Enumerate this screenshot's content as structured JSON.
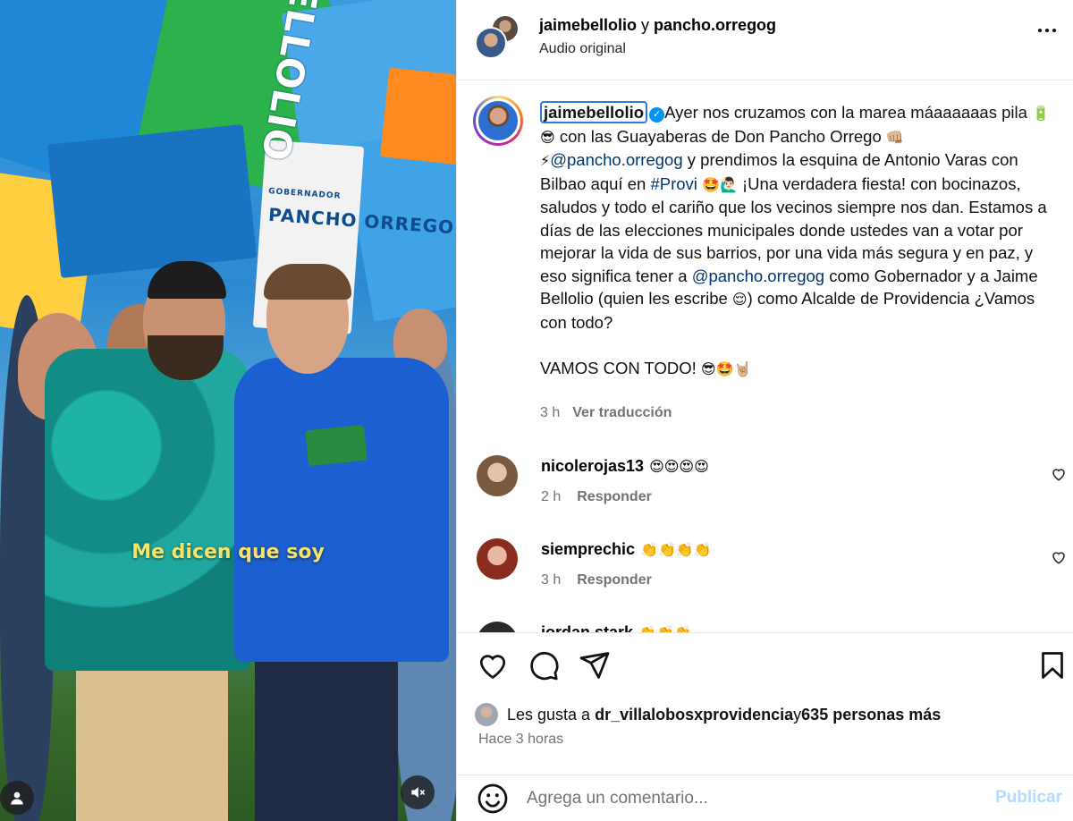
{
  "media": {
    "caption": "Me dicen que soy",
    "flag_texts": [
      "PANCHO ORREGO",
      "GOBERNADOR",
      "BELLOLIO"
    ]
  },
  "header": {
    "user1": "jaimebellolio",
    "joiner": " y ",
    "user2": "pancho.orregog",
    "audio": "Audio original"
  },
  "post": {
    "author": "jaimebellolio",
    "segments": {
      "a": "Ayer nos cruzamos con la marea máaaaaaas pila ",
      "b": " con las Guayaberas de Don Pancho Orrego ",
      "c": "@pancho.orregog",
      "d": " y prendimos la esquina de Antonio Varas con Bilbao aquí en ",
      "e": "#Provi",
      "f": " ¡Una verdadera fiesta! con bocinazos, saludos y todo el cariño que los vecinos siempre nos dan. Estamos a días de las elecciones municipales donde ustedes van a votar por mejorar la vida de sus barrios, por una vida más segura y en paz, y eso significa tener a ",
      "g": "@pancho.orregog",
      "h": " como Gobernador y a Jaime Bellolio (quien les escribe ",
      "i": ") como Alcalde de Providencia ¿Vamos con todo?",
      "j": "VAMOS CON TODO! "
    },
    "emoji": {
      "e1": "🔋 😎",
      "e2": "👊🏼",
      "e3": "⚡",
      "e4": "🤩🙋🏻‍♂️",
      "e5": "😌",
      "e6": "😎🤩🤘🏼"
    },
    "time": "3 h",
    "translate": "Ver traducción"
  },
  "comments": [
    {
      "user": "nicolerojas13",
      "text": "😍😍😍😍",
      "time": "2 h",
      "reply": "Responder"
    },
    {
      "user": "siemprechic",
      "text": "👏👏👏👏",
      "time": "3 h",
      "reply": "Responder"
    },
    {
      "user": "jordan.stark",
      "text": "👏👏👏",
      "time": "",
      "reply": ""
    }
  ],
  "likes": {
    "prefix": "Les gusta a ",
    "user": "dr_villalobosxprovidencia",
    "middle": " y ",
    "count": "635 personas más"
  },
  "time_ago": "Hace 3 horas",
  "composer": {
    "placeholder": "Agrega un comentario...",
    "publish": "Publicar"
  },
  "colors": {
    "link": "#00376b",
    "verified": "#0095f6",
    "muted": "#737373",
    "publish_disabled": "#b3dbff"
  }
}
